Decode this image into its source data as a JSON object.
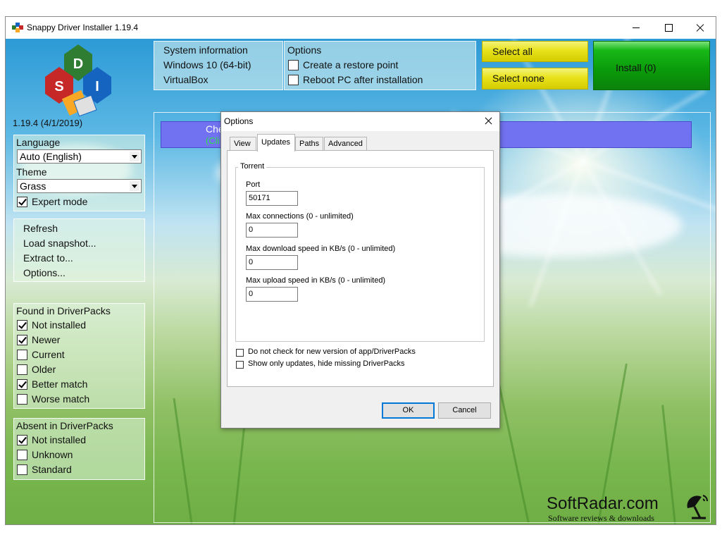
{
  "window": {
    "title": "Snappy Driver Installer 1.19.4"
  },
  "app": {
    "version": "1.19.4 (4/1/2019)",
    "logo_letters": [
      "D",
      "S",
      "I"
    ]
  },
  "sidebar": {
    "language_label": "Language",
    "language_value": "Auto (English)",
    "theme_label": "Theme",
    "theme_value": "Grass",
    "expert_mode": {
      "label": "Expert mode",
      "checked": true
    },
    "actions": [
      "Refresh",
      "Load snapshot...",
      "Extract to...",
      "Options..."
    ],
    "found_group": {
      "title": "Found in DriverPacks",
      "items": [
        {
          "label": "Not installed",
          "checked": true
        },
        {
          "label": "Newer",
          "checked": true
        },
        {
          "label": "Current",
          "checked": false
        },
        {
          "label": "Older",
          "checked": false
        },
        {
          "label": "Better match",
          "checked": true
        },
        {
          "label": "Worse match",
          "checked": false
        }
      ]
    },
    "absent_group": {
      "title": "Absent in DriverPacks",
      "items": [
        {
          "label": "Not installed",
          "checked": true
        },
        {
          "label": "Unknown",
          "checked": false
        },
        {
          "label": "Standard",
          "checked": false
        }
      ]
    }
  },
  "header": {
    "system_info": {
      "title": "System information",
      "os": "Windows 10 (64-bit)",
      "machine": "VirtualBox"
    },
    "options": {
      "title": "Options",
      "restore_point": {
        "label": "Create a restore point",
        "checked": false
      },
      "reboot": {
        "label": "Reboot PC after installation",
        "checked": false
      }
    },
    "select_all": "Select all",
    "select_none": "Select none",
    "install": "Install (0)"
  },
  "status": {
    "line1": "Checking for updates",
    "line2": "(Cli"
  },
  "dialog": {
    "title": "Options",
    "tabs": [
      "View",
      "Updates",
      "Paths",
      "Advanced"
    ],
    "active_tab": "Updates",
    "group_title": "Torrent",
    "fields": [
      {
        "label": "Port",
        "value": "50171"
      },
      {
        "label": "Max connections (0 - unlimited)",
        "value": "0"
      },
      {
        "label": "Max download speed in KB/s (0 - unlimited)",
        "value": "0"
      },
      {
        "label": "Max upload speed in KB/s (0 - unlimited)",
        "value": "0"
      }
    ],
    "checkboxes": [
      {
        "label": "Do not check for new version of app/DriverPacks",
        "checked": false
      },
      {
        "label": "Show only updates, hide missing DriverPacks",
        "checked": false
      }
    ],
    "ok": "OK",
    "cancel": "Cancel"
  },
  "watermark": {
    "main": "SoftRadar.com",
    "sub": "Software reviews & downloads"
  },
  "colors": {
    "status_bar": "#7172f1",
    "select_buttons": "#e8e21a",
    "install_button": "#0a9a0a",
    "logo_blue": "#1565c0",
    "logo_red": "#c62828",
    "logo_green": "#2e7d32"
  }
}
